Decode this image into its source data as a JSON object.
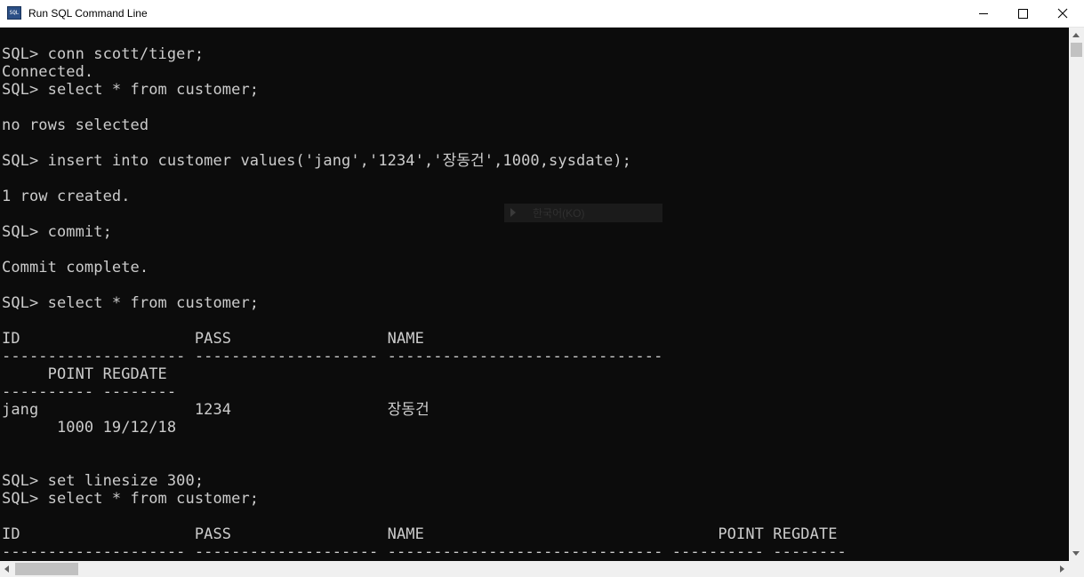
{
  "window": {
    "title": "Run SQL Command Line",
    "icon": "sql-plus-app-icon",
    "icon_text": "SQL",
    "controls": [
      "minimize-icon",
      "maximize-icon",
      "close-icon"
    ]
  },
  "console": {
    "background": "#0c0c0c",
    "foreground": "#cccccc",
    "lines": [
      "SQL> conn scott/tiger;",
      "Connected.",
      "SQL> select * from customer;",
      "",
      "no rows selected",
      "",
      "SQL> insert into customer values('jang','1234','장동건',1000,sysdate);",
      "",
      "1 row created.",
      "",
      "SQL> commit;",
      "",
      "Commit complete.",
      "",
      "SQL> select * from customer;",
      "",
      "ID                   PASS                 NAME",
      "-------------------- -------------------- ------------------------------",
      "     POINT REGDATE",
      "---------- --------",
      "jang                 1234                 장동건",
      "      1000 19/12/18",
      "",
      "",
      "SQL> set linesize 300;",
      "SQL> select * from customer;",
      "",
      "ID                   PASS                 NAME                                POINT REGDATE",
      "-------------------- -------------------- ------------------------------ ---------- --------"
    ]
  },
  "ghost_tooltip": {
    "icon": "play-arrow-icon",
    "text": "한국어(KO)"
  }
}
